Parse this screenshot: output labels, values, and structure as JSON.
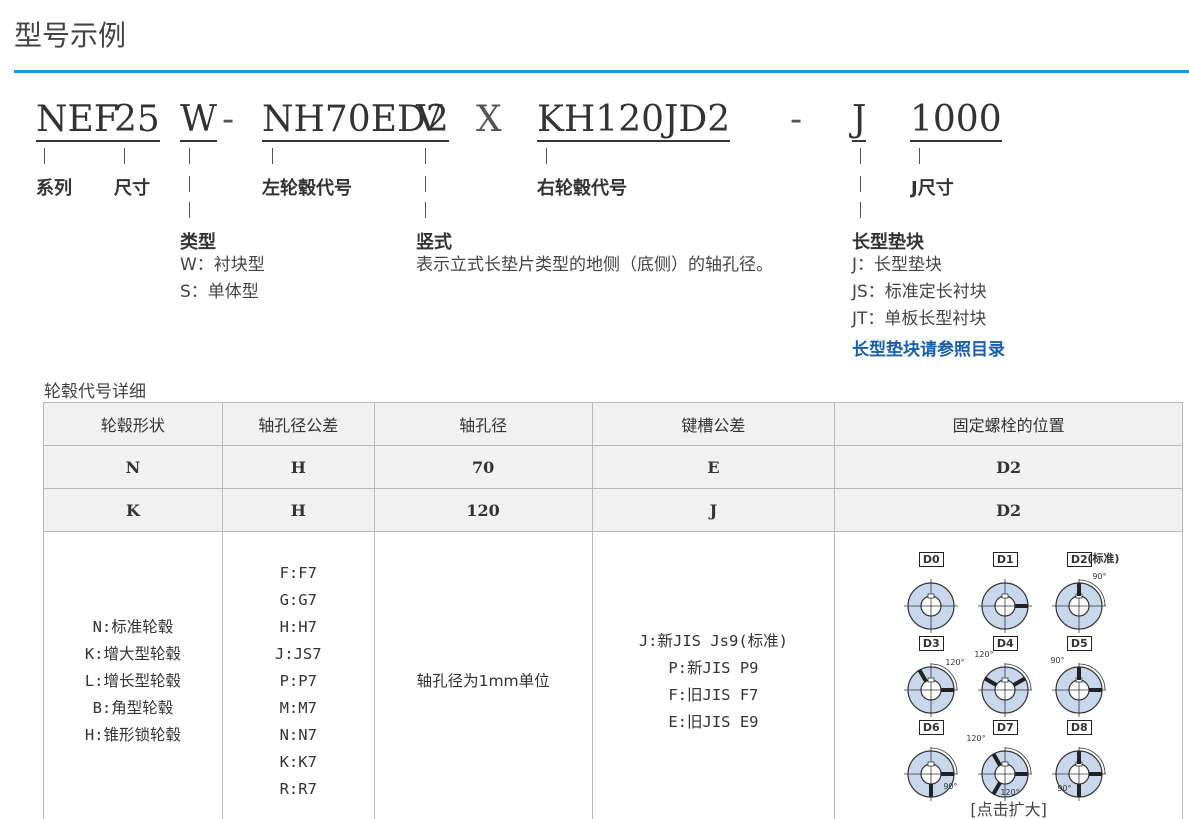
{
  "page": {
    "title": "型号示例"
  },
  "code": {
    "series": "NEF",
    "size": "25",
    "type": "W",
    "dash1": "-",
    "left_hub": "NH70ED2",
    "vertical": "V",
    "x": "X",
    "right_hub": "KH120JD2",
    "dash2": "-",
    "spacer": "J",
    "j_size": "1000"
  },
  "labels": {
    "series": "系列",
    "size": "尺寸",
    "left_hub": "左轮毂代号",
    "right_hub": "右轮毂代号",
    "j_size": "J尺寸",
    "type": "类型",
    "vertical": "竖式",
    "spacer": "长型垫块"
  },
  "descriptions": {
    "type": [
      "W：衬块型",
      "S：单体型"
    ],
    "vertical": [
      "表示立式长垫片类型的地侧（底侧）的轴孔径。"
    ],
    "spacer": [
      "J：长型垫块",
      "JS：标准定长衬块",
      "JT：单板长型衬块"
    ],
    "spacer_link": "长型垫块请参照目录"
  },
  "table": {
    "caption": "轮毂代号详细",
    "headers": [
      "轮毂形状",
      "轴孔径公差",
      "轴孔径",
      "键槽公差",
      "固定螺栓的位置"
    ],
    "rows": [
      [
        "N",
        "H",
        "70",
        "E",
        "D2"
      ],
      [
        "K",
        "H",
        "120",
        "J",
        "D2"
      ]
    ],
    "detail": {
      "shapes": [
        "N:标准轮毂",
        "K:增大型轮毂",
        "L:增长型轮毂",
        "B:角型轮毂",
        "H:锥形锁轮毂"
      ],
      "tolerances": [
        "F:F7",
        "G:G7",
        "H:H7",
        "J:JS7",
        "P:P7",
        "M:M7",
        "N:N7",
        "K:K7",
        "R:R7"
      ],
      "bore": "轴孔径为1mm单位",
      "keyway": [
        "J:新JIS Js9(标准)",
        "P:新JIS P9",
        "F:旧JIS F7",
        "E:旧JIS E9"
      ],
      "positions": [
        "D0",
        "D1",
        "D2",
        "D3",
        "D4",
        "D5",
        "D6",
        "D7",
        "D8"
      ],
      "standard_note": "(标准)",
      "angles": {
        "a90": "90°",
        "a120": "120°"
      },
      "enlarge": "[点击扩大]"
    }
  }
}
